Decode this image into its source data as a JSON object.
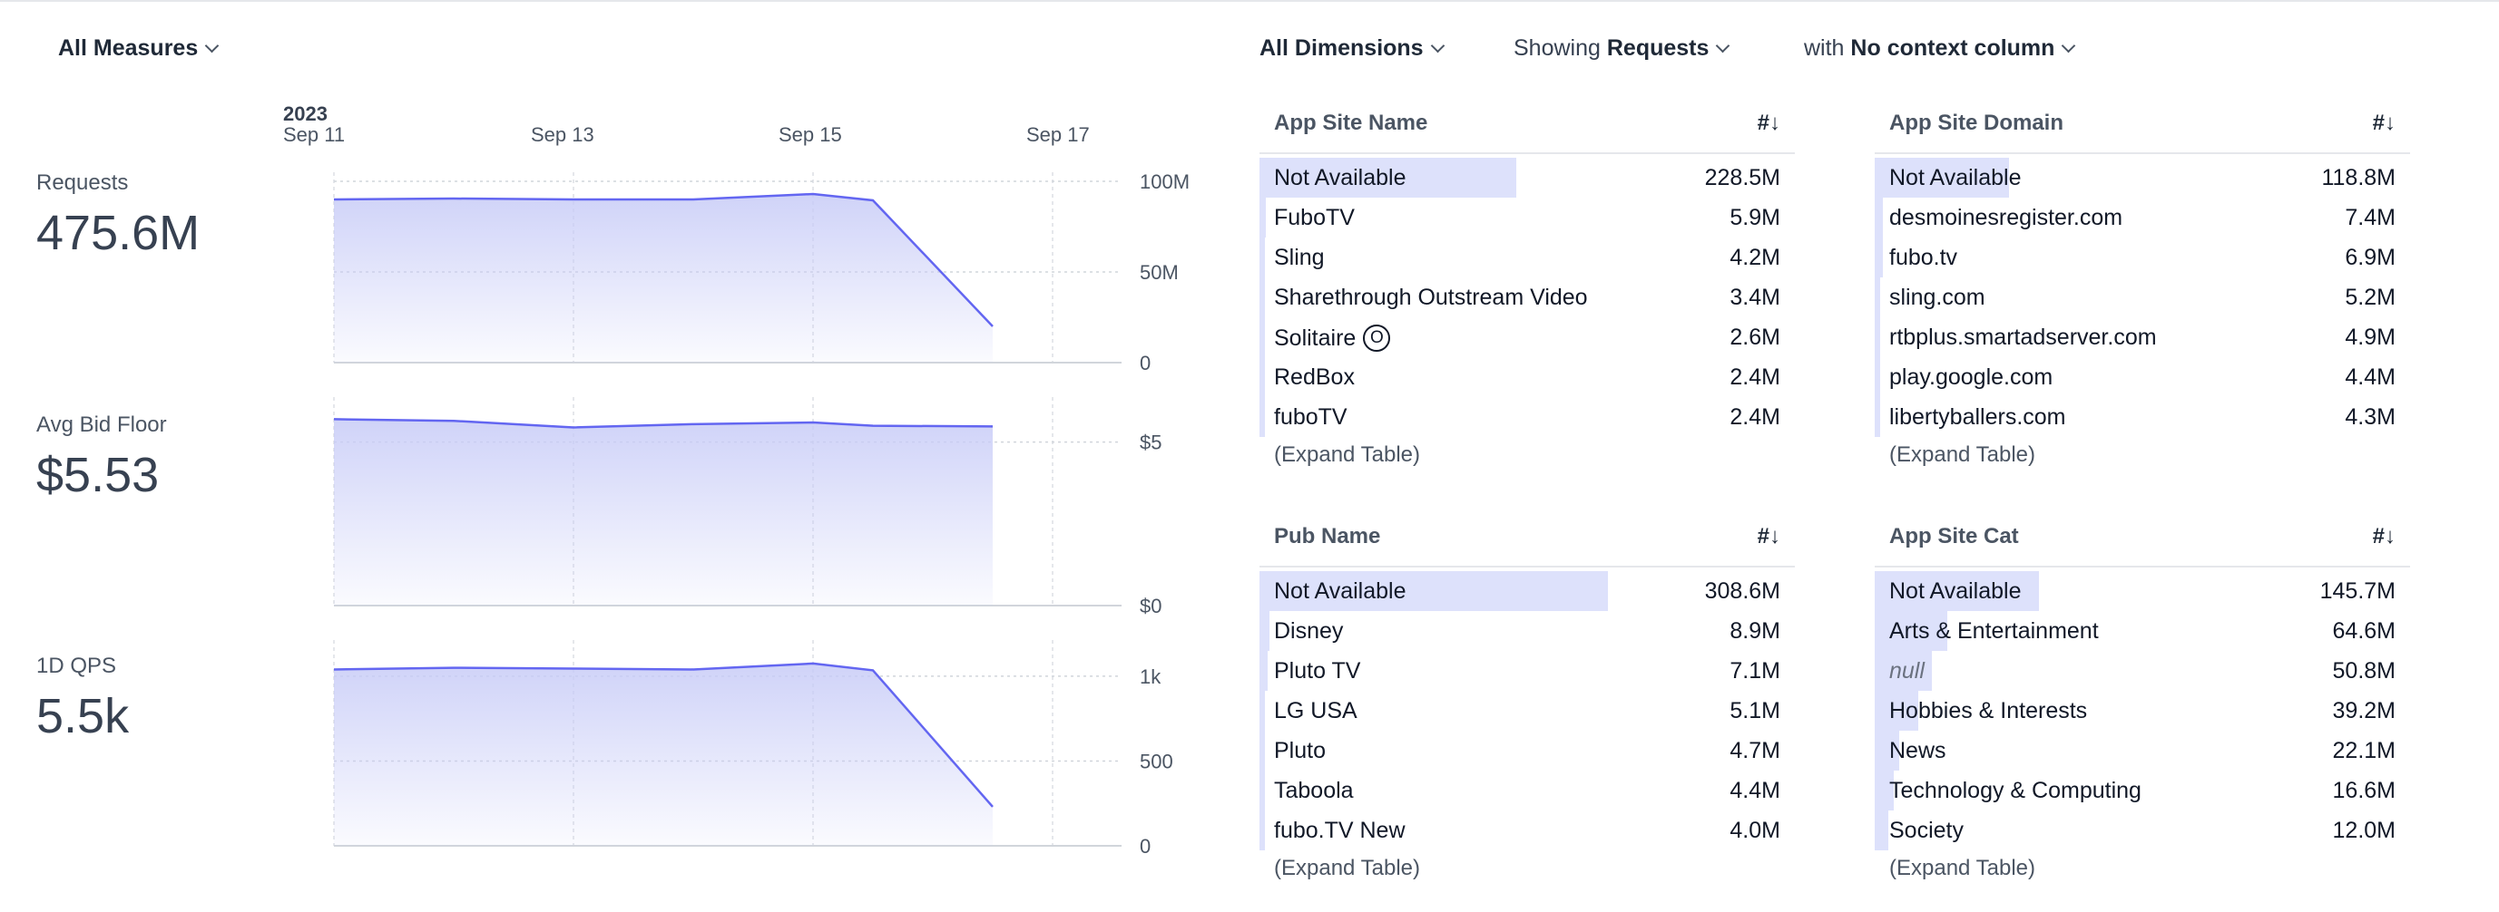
{
  "toolbar": {
    "all_measures": "All Measures",
    "all_dimensions": "All Dimensions",
    "showing_prefix": "Showing",
    "showing_value": "Requests",
    "with_prefix": "with",
    "context_value": "No context column"
  },
  "time_axis": {
    "year": "2023",
    "dates": [
      "Sep 11",
      "Sep 13",
      "Sep 15",
      "Sep 17"
    ]
  },
  "measures": [
    {
      "label": "Requests",
      "value": "475.6M",
      "y_ticks": [
        "100M",
        "50M",
        "0"
      ]
    },
    {
      "label": "Avg Bid Floor",
      "value": "$5.53",
      "y_ticks": [
        "$5",
        "$0"
      ]
    },
    {
      "label": "1D QPS",
      "value": "5.5k",
      "y_ticks": [
        "1k",
        "500",
        "0"
      ]
    }
  ],
  "chart_data": [
    {
      "type": "area",
      "title": "Requests",
      "x": [
        "2023-09-11",
        "2023-09-12",
        "2023-09-13",
        "2023-09-14",
        "2023-09-15",
        "2023-09-16",
        "2023-09-17"
      ],
      "values": [
        90000000,
        90500000,
        90000000,
        90000000,
        93000000,
        89500000,
        20000000
      ],
      "ylim": [
        0,
        100000000
      ]
    },
    {
      "type": "area",
      "title": "Avg Bid Floor",
      "x": [
        "2023-09-11",
        "2023-09-12",
        "2023-09-13",
        "2023-09-14",
        "2023-09-15",
        "2023-09-16",
        "2023-09-17"
      ],
      "values": [
        5.7,
        5.65,
        5.45,
        5.55,
        5.6,
        5.5,
        5.48
      ],
      "ylim": [
        0,
        5
      ]
    },
    {
      "type": "area",
      "title": "1D QPS",
      "x": [
        "2023-09-11",
        "2023-09-12",
        "2023-09-13",
        "2023-09-14",
        "2023-09-15",
        "2023-09-16",
        "2023-09-17"
      ],
      "values": [
        1040,
        1050,
        1045,
        1040,
        1075,
        1035,
        230
      ],
      "ylim": [
        0,
        1000
      ]
    }
  ],
  "leaderboards": [
    {
      "title": "App Site Name",
      "sort_label": "#",
      "expand": "(Expand Table)",
      "rows": [
        {
          "label": "Not Available",
          "value": "228.5M",
          "share": 0.48
        },
        {
          "label": "FuboTV",
          "value": "5.9M",
          "share": 0.012
        },
        {
          "label": "Sling",
          "value": "4.2M",
          "share": 0.009
        },
        {
          "label": "Sharethrough Outstream Video",
          "value": "3.4M",
          "share": 0.007
        },
        {
          "label": "Solitaire",
          "value": "2.6M",
          "share": 0.005,
          "badge": "O"
        },
        {
          "label": "RedBox",
          "value": "2.4M",
          "share": 0.005
        },
        {
          "label": "fuboTV",
          "value": "2.4M",
          "share": 0.005
        }
      ]
    },
    {
      "title": "App Site Domain",
      "sort_label": "#",
      "expand": "(Expand Table)",
      "rows": [
        {
          "label": "Not Available",
          "value": "118.8M",
          "share": 0.25
        },
        {
          "label": "desmoinesregister.com",
          "value": "7.4M",
          "share": 0.016
        },
        {
          "label": "fubo.tv",
          "value": "6.9M",
          "share": 0.015
        },
        {
          "label": "sling.com",
          "value": "5.2M",
          "share": 0.011
        },
        {
          "label": "rtbplus.smartadserver.com",
          "value": "4.9M",
          "share": 0.01
        },
        {
          "label": "play.google.com",
          "value": "4.4M",
          "share": 0.009
        },
        {
          "label": "libertyballers.com",
          "value": "4.3M",
          "share": 0.009
        }
      ]
    },
    {
      "title": "Pub Name",
      "sort_label": "#",
      "expand": "(Expand Table)",
      "rows": [
        {
          "label": "Not Available",
          "value": "308.6M",
          "share": 0.65
        },
        {
          "label": "Disney",
          "value": "8.9M",
          "share": 0.019
        },
        {
          "label": "Pluto TV",
          "value": "7.1M",
          "share": 0.015
        },
        {
          "label": "LG USA",
          "value": "5.1M",
          "share": 0.011
        },
        {
          "label": "Pluto",
          "value": "4.7M",
          "share": 0.01
        },
        {
          "label": "Taboola",
          "value": "4.4M",
          "share": 0.009
        },
        {
          "label": "fubo.TV New",
          "value": "4.0M",
          "share": 0.008
        }
      ]
    },
    {
      "title": "App Site Cat",
      "sort_label": "#",
      "expand": "(Expand Table)",
      "rows": [
        {
          "label": "Not Available",
          "value": "145.7M",
          "share": 0.306
        },
        {
          "label": "Arts & Entertainment",
          "value": "64.6M",
          "share": 0.136
        },
        {
          "label": "null",
          "value": "50.8M",
          "share": 0.107,
          "is_null": true
        },
        {
          "label": "Hobbies & Interests",
          "value": "39.2M",
          "share": 0.082
        },
        {
          "label": "News",
          "value": "22.1M",
          "share": 0.046
        },
        {
          "label": "Technology & Computing",
          "value": "16.6M",
          "share": 0.035
        },
        {
          "label": "Society",
          "value": "12.0M",
          "share": 0.025
        }
      ]
    }
  ],
  "colors": {
    "accent_line": "#6366f1",
    "area_fill": "#c7cbf7",
    "leaderboard_bar": "#dde1fb"
  }
}
